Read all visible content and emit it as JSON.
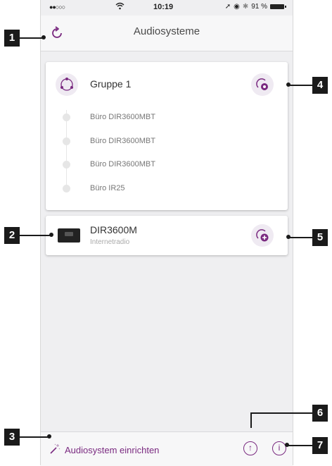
{
  "status_bar": {
    "signal": "●●○○○",
    "time": "10:19",
    "battery": "91 %"
  },
  "header": {
    "title": "Audiosysteme"
  },
  "group_card": {
    "title": "Gruppe 1",
    "members": [
      "Büro DIR3600MBT",
      "Büro DIR3600MBT",
      "Büro DIR3600MBT",
      "Büro IR25"
    ]
  },
  "device_card": {
    "name": "DIR3600M",
    "subtitle": "Internetradio"
  },
  "bottom_bar": {
    "setup_label": "Audiosystem einrichten"
  },
  "callouts": [
    "1",
    "2",
    "3",
    "4",
    "5",
    "6",
    "7"
  ],
  "colors": {
    "accent": "#7a2a80",
    "background": "#efeff1",
    "callout": "#1a1a1a"
  }
}
